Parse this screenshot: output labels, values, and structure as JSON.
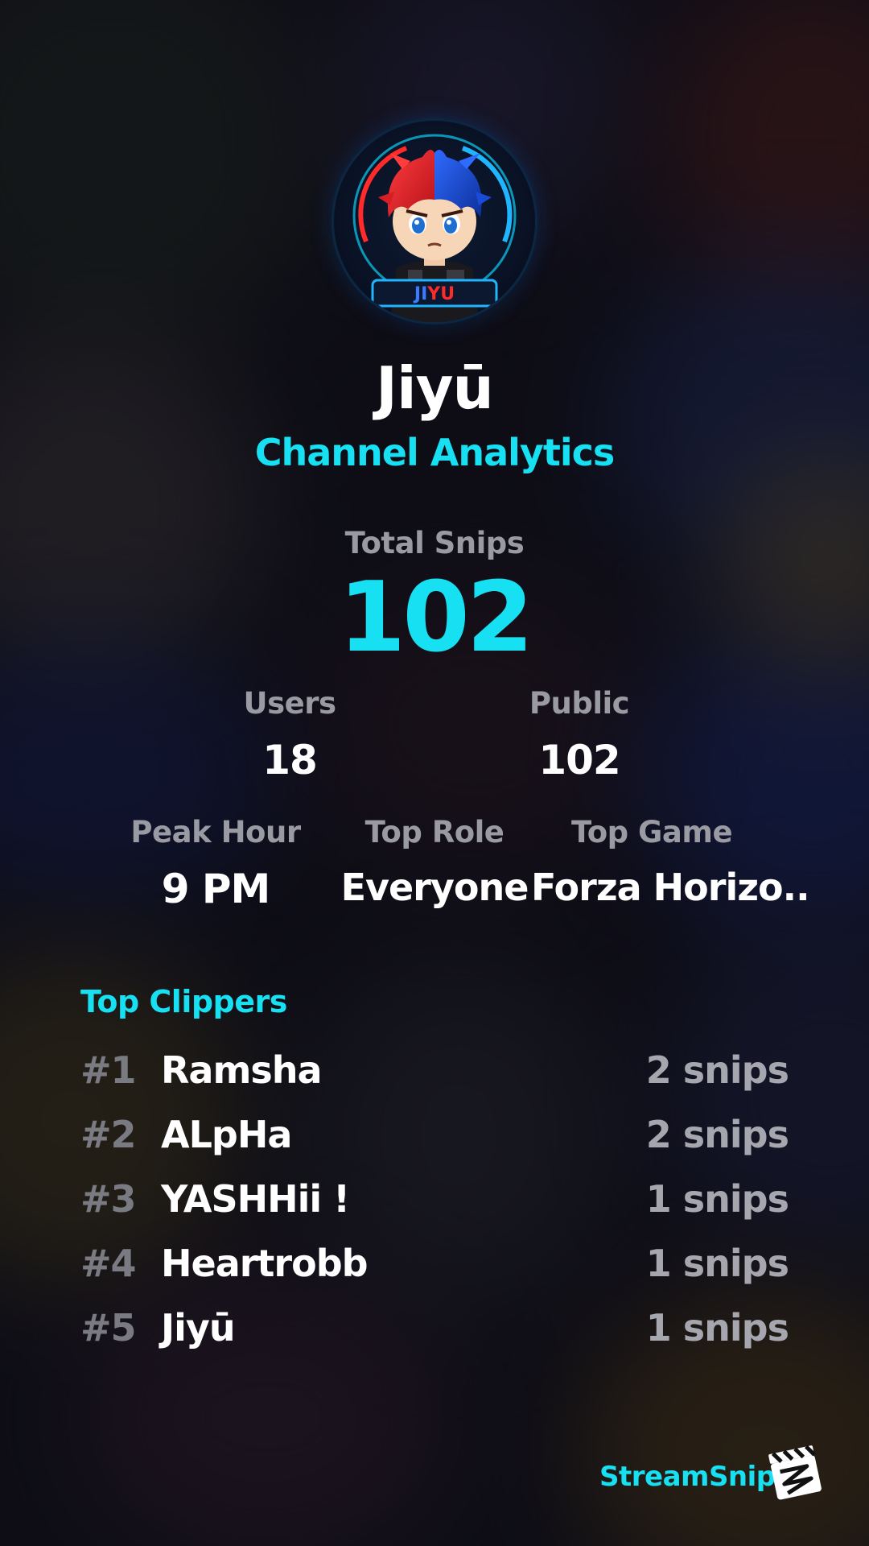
{
  "channel": {
    "name": "Jiyū",
    "subtitle": "Channel Analytics",
    "avatar_badge": "JIYU"
  },
  "stats": {
    "total_snips_label": "Total Snips",
    "total_snips_value": "102",
    "users_label": "Users",
    "users_value": "18",
    "public_label": "Public",
    "public_value": "102",
    "peak_hour_label": "Peak Hour",
    "peak_hour_value": "9 PM",
    "top_role_label": "Top Role",
    "top_role_value": "Everyone",
    "top_game_label": "Top Game",
    "top_game_value": "Forza Horizo.."
  },
  "top_clippers": {
    "title": "Top Clippers",
    "rows": [
      {
        "rank": "#1",
        "name": "Ramsha",
        "count": "2 snips"
      },
      {
        "rank": "#2",
        "name": "ALpHa",
        "count": "2 snips"
      },
      {
        "rank": "#3",
        "name": "YASHHii !",
        "count": "1 snips"
      },
      {
        "rank": "#4",
        "name": "Heartrobb",
        "count": "1 snips"
      },
      {
        "rank": "#5",
        "name": "Jiyū",
        "count": "1 snips"
      }
    ]
  },
  "brand": {
    "name": "StreamSnip",
    "logo_icon": "clapperboard-icon"
  },
  "colors": {
    "accent": "#16e0f2",
    "label": "#9a9aa2",
    "value": "#ffffff",
    "background": "#14131d"
  }
}
